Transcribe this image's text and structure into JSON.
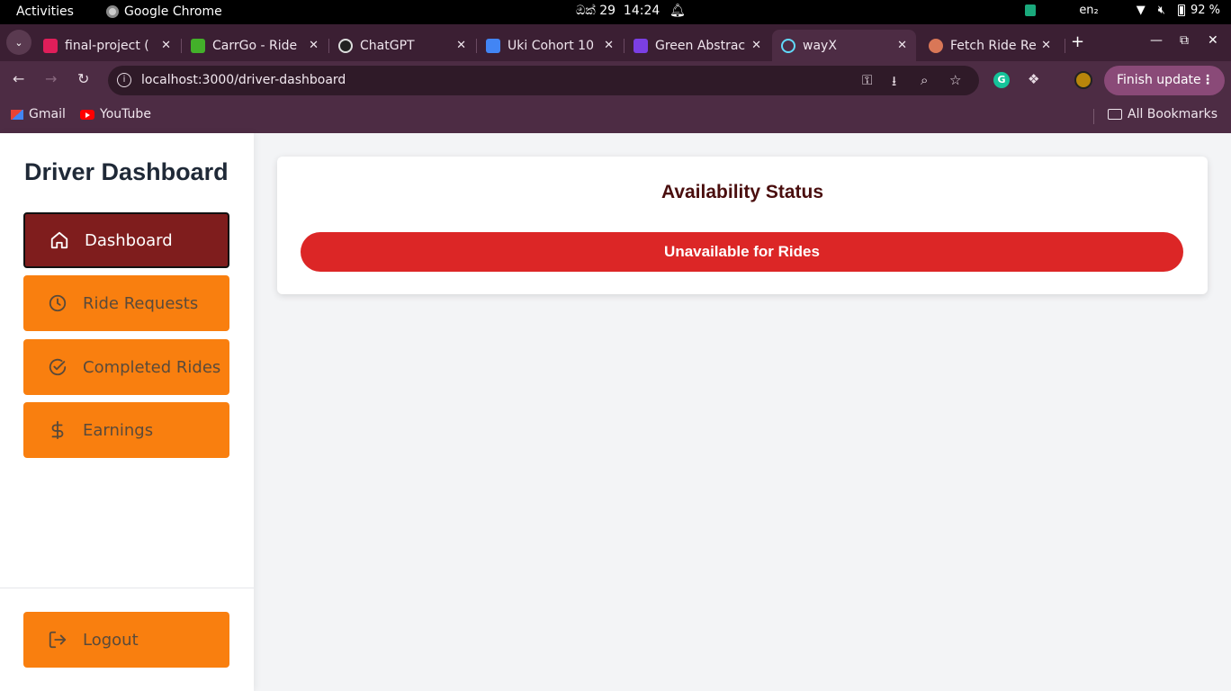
{
  "system": {
    "activities": "Activities",
    "app_name": "Google Chrome",
    "date": "ඔක් 29",
    "time": "14:24",
    "keyboard": "en₂",
    "battery": "92 %"
  },
  "tabs": [
    {
      "label": "final-project (",
      "favicon_color": "#e01e5a",
      "icon": "slack-icon"
    },
    {
      "label": "CarrGo - Ride",
      "favicon_color": "#43b02a",
      "icon": "carrgo-icon"
    },
    {
      "label": "ChatGPT",
      "favicon_color": "#222222",
      "icon": "chatgpt-icon"
    },
    {
      "label": "Uki Cohort 10",
      "favicon_color": "#4285f4",
      "icon": "classroom-icon"
    },
    {
      "label": "Green Abstrac",
      "favicon_color": "#7b3fe4",
      "icon": "canva-icon"
    },
    {
      "label": "wayX",
      "favicon_color": "#61dafb",
      "icon": "react-icon",
      "active": true
    },
    {
      "label": "Fetch Ride Re",
      "favicon_color": "#d97757",
      "icon": "claude-icon"
    }
  ],
  "address_bar": {
    "url": "localhost:3000/driver-dashboard"
  },
  "finish_update": "Finish update",
  "bookmarks": {
    "gmail": "Gmail",
    "youtube": "YouTube",
    "all": "All Bookmarks"
  },
  "sidebar": {
    "title": "Driver Dashboard",
    "items": [
      {
        "label": "Dashboard",
        "icon": "home-icon",
        "active": true
      },
      {
        "label": "Ride Requests",
        "icon": "clock-icon"
      },
      {
        "label": "Completed Rides",
        "icon": "check-circle-icon"
      },
      {
        "label": "Earnings",
        "icon": "dollar-icon"
      }
    ],
    "logout": "Logout"
  },
  "availability": {
    "heading": "Availability Status",
    "button_label": "Unavailable for Rides"
  },
  "colors": {
    "nav_orange": "#f97f0f",
    "nav_active": "#7f1d1d",
    "status_red": "#dc2626"
  }
}
